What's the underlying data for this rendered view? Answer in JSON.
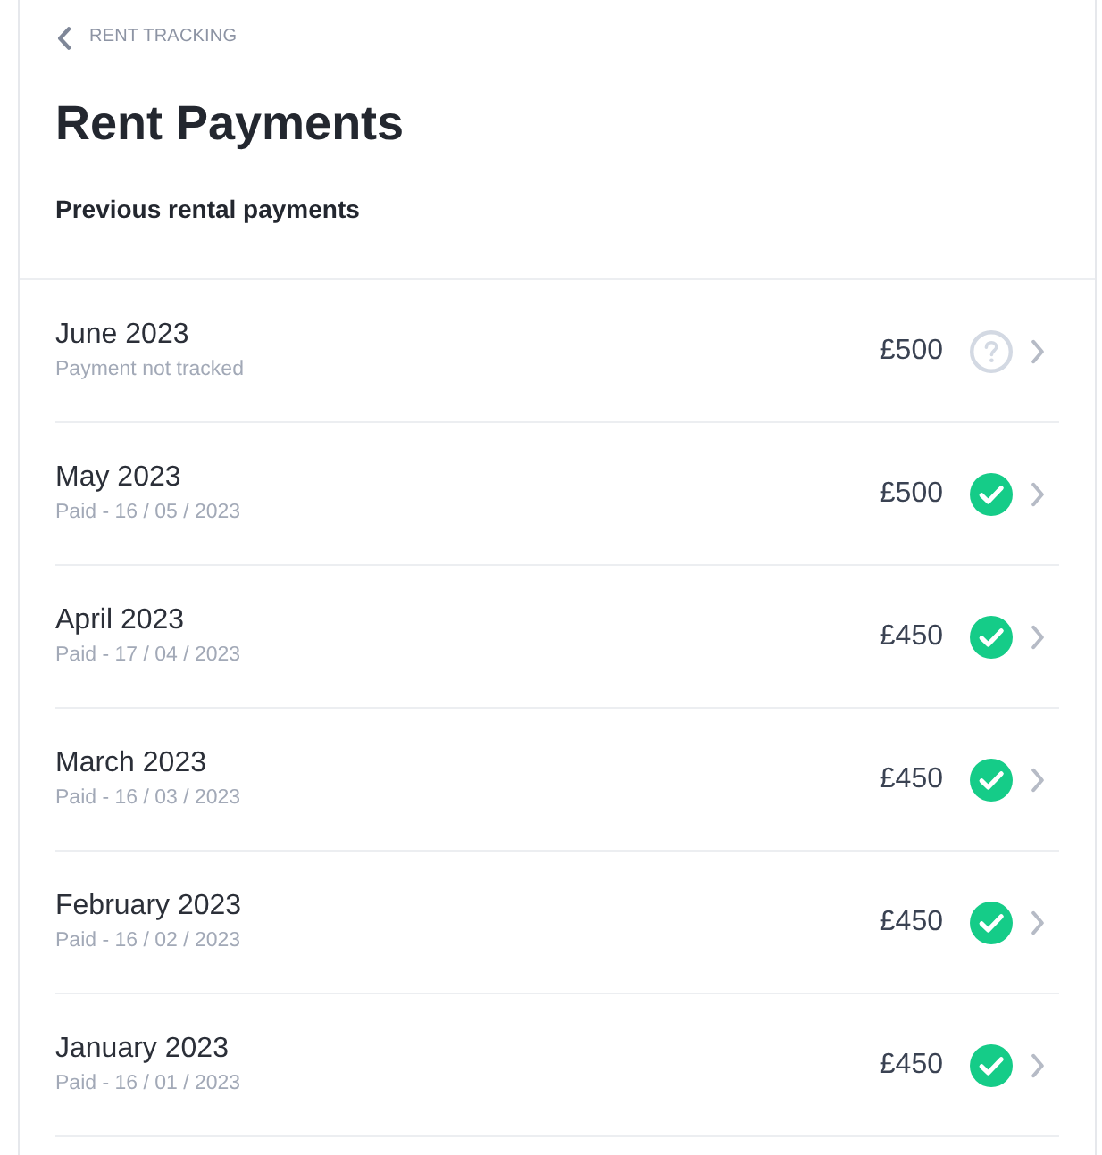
{
  "breadcrumb": {
    "label": "RENT TRACKING"
  },
  "title": "Rent Payments",
  "section_heading": "Previous rental payments",
  "payments": [
    {
      "month": "June 2023",
      "detail": "Payment not tracked",
      "amount": "£500",
      "kind": "untracked"
    },
    {
      "month": "May 2023",
      "detail": "Paid - 16 / 05 / 2023",
      "amount": "£500",
      "kind": "paid"
    },
    {
      "month": "April 2023",
      "detail": "Paid - 17 / 04 / 2023",
      "amount": "£450",
      "kind": "paid"
    },
    {
      "month": "March 2023",
      "detail": "Paid - 16 / 03 / 2023",
      "amount": "£450",
      "kind": "paid"
    },
    {
      "month": "February 2023",
      "detail": "Paid - 16 / 02 / 2023",
      "amount": "£450",
      "kind": "paid"
    },
    {
      "month": "January 2023",
      "detail": "Paid - 16 / 01 / 2023",
      "amount": "£450",
      "kind": "paid"
    }
  ]
}
